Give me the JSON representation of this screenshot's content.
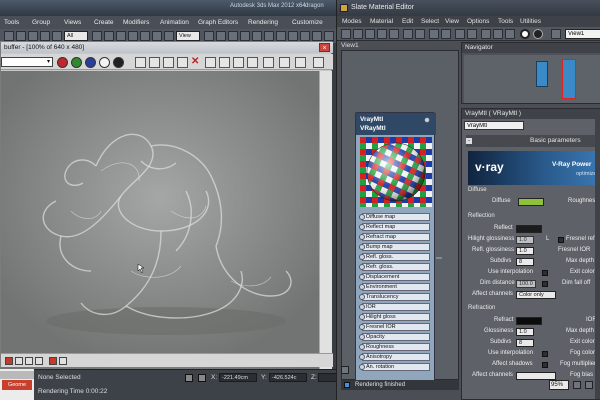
{
  "max": {
    "title": "Autodesk 3ds Max 2012 x64",
    "title_extra": "dragon",
    "menu": [
      "Tools",
      "Group",
      "Views",
      "Create",
      "Modifiers",
      "Animation",
      "Graph Editors",
      "Rendering",
      "Customize"
    ],
    "toolbar": {
      "filter_value": "All",
      "view_value": "View"
    }
  },
  "framebuffer": {
    "title": "buffer - [100% of 640 x 480]",
    "close": "×"
  },
  "statusbar": {
    "left_tab": "Geome",
    "selection": "None Selected",
    "render_time": "Rendering Time 0:00:22",
    "x_label": "X:",
    "x_value": "-221.49cm",
    "y_label": "Y:",
    "y_value": "-426.524c",
    "z_label": "Z:"
  },
  "sme": {
    "title": "Slate Material Editor",
    "menu": [
      "Modes",
      "Material",
      "Edit",
      "Select",
      "View",
      "Options",
      "Tools",
      "Utilities"
    ],
    "view_input": "View1",
    "view_tab": "View1",
    "navigator_title": "Navigator",
    "params_title": "VrayMtl  ( VRayMtl )",
    "material_name": "VrayMtl",
    "rollout": "Basic parameters",
    "banner_logo": "v·ray",
    "banner_power": "V-Ray Power",
    "banner_opt": "optimized",
    "status": "Rendering finished",
    "zoom": "95%"
  },
  "node": {
    "title1": "VrayMtl",
    "title2": "VRayMtl",
    "slots": [
      "Diffuse map",
      "Reflect map",
      "Refract map",
      "Bump map",
      "Refl. gloss.",
      "Refr. gloss.",
      "Displacement",
      "Environment",
      "Translucency",
      "IOR",
      "Hilight gloss",
      "Fresnel IOR",
      "Opacity",
      "Roughness",
      "Anisotropy",
      "An. rotation"
    ]
  },
  "params": {
    "diffuse_group": "Diffuse",
    "diffuse_label": "Diffuse",
    "roughness_label": "Roughness",
    "reflection_group": "Reflection",
    "reflect_label": "Reflect",
    "hilight_label": "Hilight glossiness",
    "hilight_value": "1.0",
    "l_label": "L",
    "fresnel_label": "Fresnel refl",
    "refl_gloss_label": "Refl. glossiness",
    "refl_gloss_value": "1.0",
    "fresnel_ior_label": "Fresnel IOR",
    "subdivs_label": "Subdivs",
    "subdivs_value": "8",
    "max_depth_label": "Max depth",
    "use_interp_label": "Use interpolation",
    "exit_color_label": "Exit color",
    "dim_distance_label": "Dim distance",
    "dim_distance_value": "100.0",
    "dim_falloff_label": "Dim fall off",
    "affect_channels_label": "Affect channels",
    "affect_channels_value": "Color only",
    "refraction_group": "Refraction",
    "refract_label": "Refract",
    "ior_label": "IOR",
    "r_gloss_label": "Glossiness",
    "r_gloss_value": "1.0",
    "r_max_depth_label": "Max depth",
    "r_subdivs_label": "Subdivs",
    "r_subdivs_value": "8",
    "r_exit_color_label": "Exit color",
    "r_use_interp_label": "Use interpolation",
    "fog_color_label": "Fog color",
    "affect_shadows_label": "Affect shadows",
    "fog_mult_label": "Fog multiplier",
    "r_affect_channels_label": "Affect channels",
    "fog_bias_label": "Fog bias",
    "colors": {
      "diffuse": "#8fc13a",
      "reflect": "#1c1c1c",
      "refract": "#0c0c0c"
    }
  }
}
